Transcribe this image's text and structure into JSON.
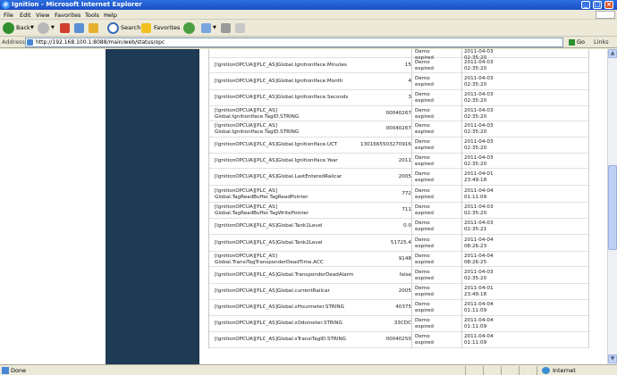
{
  "window": {
    "title": "Ignition - Microsoft Internet Explorer"
  },
  "menu": [
    "File",
    "Edit",
    "View",
    "Favorites",
    "Tools",
    "Help"
  ],
  "toolbar": {
    "back_label": "Back",
    "search_label": "Search",
    "favorites_label": "Favorites"
  },
  "address": {
    "label": "Address",
    "url": "http://192.168.100.1:8088/main/web/status/opc",
    "go_label": "Go",
    "links_label": "Links"
  },
  "rows": [
    {
      "name": "",
      "value": "",
      "quality": "Demo\nexpired",
      "timestamp": "2011-04-03\n02:35:20"
    },
    {
      "name": "[IgnitionOPCUA][PLC_AS]Global.IgnitionIface.Minutes",
      "value": "15",
      "quality": "Demo\nexpired",
      "timestamp": "2011-04-03\n02:35:20"
    },
    {
      "name": "[IgnitionOPCUA][PLC_AS]Global.IgnitionIface.Month",
      "value": "4",
      "quality": "Demo\nexpired",
      "timestamp": "2011-04-03\n02:35:20"
    },
    {
      "name": "[IgnitionOPCUA][PLC_AS]Global.IgnitionIface.Seconds",
      "value": "3",
      "quality": "Demo\nexpired",
      "timestamp": "2011-04-03\n02:35:20"
    },
    {
      "name": "[IgnitionOPCUA][PLC_AS]\nGlobal.IgnitionIface.TagID.STRING",
      "value": "00040267",
      "quality": "Demo\nexpired",
      "timestamp": "2011-04-03\n02:35:20"
    },
    {
      "name": "[IgnitionOPCUA][PLC_AS]\nGlobal.IgnitionIface.TagID.STRING",
      "value": "00040267",
      "quality": "Demo\nexpired",
      "timestamp": "2011-04-03\n02:35:20"
    },
    {
      "name": "[IgnitionOPCUA][PLC_AS]Global.IgnitionIface.UCT",
      "value": "1301665503270916",
      "quality": "Demo\nexpired",
      "timestamp": "2011-04-03\n02:35:20"
    },
    {
      "name": "[IgnitionOPCUA][PLC_AS]Global.IgnitionIface.Year",
      "value": "2011",
      "quality": "Demo\nexpired",
      "timestamp": "2011-04-03\n02:35:20"
    },
    {
      "name": "[IgnitionOPCUA][PLC_AS]Global.LastEnteredRailcar",
      "value": "2005",
      "quality": "Demo\nexpired",
      "timestamp": "2011-04-01\n23:49:18"
    },
    {
      "name": "[IgnitionOPCUA][PLC_AS]\nGlobal.TagReadBuffer.TagReadPointer",
      "value": "772",
      "quality": "Demo\nexpired",
      "timestamp": "2011-04-04\n01:11:09"
    },
    {
      "name": "[IgnitionOPCUA][PLC_AS]\nGlobal.TagReadBuffer.TagWritePointer",
      "value": "711",
      "quality": "Demo\nexpired",
      "timestamp": "2011-04-03\n02:35:20"
    },
    {
      "name": "[IgnitionOPCUA][PLC_AS]Global.Tank1Level",
      "value": "0.0",
      "quality": "Demo\nexpired",
      "timestamp": "2011-04-03\n02:35:21"
    },
    {
      "name": "[IgnitionOPCUA][PLC_AS]Global.Tank2Level",
      "value": "51725.4",
      "quality": "Demo\nexpired",
      "timestamp": "2011-04-04\n08:26:23"
    },
    {
      "name": "[IgnitionOPCUA][PLC_AS]\nGlobal.TransiTagTransponderDeadTime.ACC",
      "value": "9148",
      "quality": "Demo\nexpired",
      "timestamp": "2011-04-04\n08:26:25"
    },
    {
      "name": "[IgnitionOPCUA][PLC_AS]Global.TransponderDeadAlarm",
      "value": "false",
      "quality": "Demo\nexpired",
      "timestamp": "2011-04-03\n02:35:20"
    },
    {
      "name": "[IgnitionOPCUA][PLC_AS]Global.currentRailcar",
      "value": "2005",
      "quality": "Demo\nexpired",
      "timestamp": "2011-04-01\n23:49:18"
    },
    {
      "name": "[IgnitionOPCUA][PLC_AS]Global.sHourmeter.STRING",
      "value": "40375",
      "quality": "Demo\nexpired",
      "timestamp": "2011-04-04\n01:11:09"
    },
    {
      "name": "[IgnitionOPCUA][PLC_AS]Global.sOdometer.STRING",
      "value": "33CDC",
      "quality": "Demo\nexpired",
      "timestamp": "2011-04-04\n01:11:09"
    },
    {
      "name": "[IgnitionOPCUA][PLC_AS]Global.sTransiTagID.STRING",
      "value": "00040250",
      "quality": "Demo\nexpired",
      "timestamp": "2011-04-04\n01:11:09"
    }
  ],
  "status": {
    "text": "Done",
    "zone": "Internet"
  },
  "colors": {
    "sidebar": "#1e3a54",
    "titlebar": "#1a4fc5"
  }
}
